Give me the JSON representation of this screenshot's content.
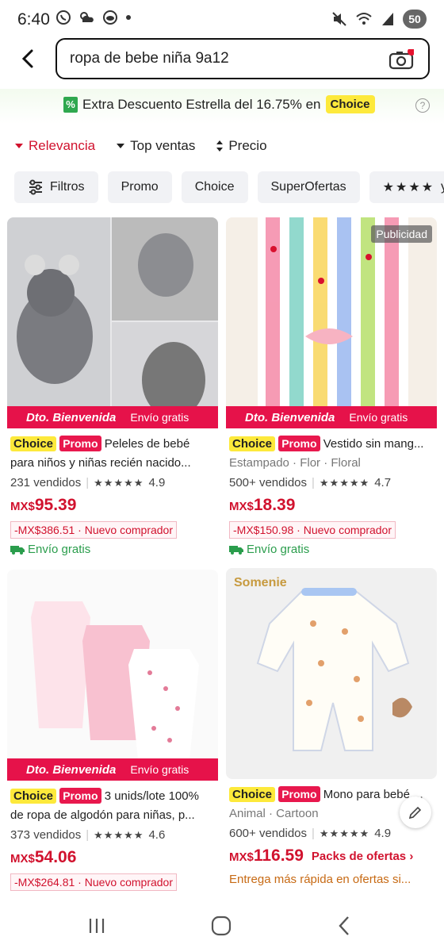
{
  "status": {
    "time": "6:40",
    "battery": "50"
  },
  "search": {
    "query": "ropa de bebe niña 9a12"
  },
  "banner": {
    "text": "Extra Descuento Estrella del 16.75% en",
    "badge": "Choice",
    "pct": "%"
  },
  "sort": [
    {
      "label": "Relevancia"
    },
    {
      "label": "Top ventas"
    },
    {
      "label": "Precio"
    }
  ],
  "chips": {
    "filters": "Filtros",
    "promo": "Promo",
    "choice": "Choice",
    "superofertas": "SuperOfertas",
    "stars_suffix": "y"
  },
  "dto": {
    "title": "Dto. Bienvenida",
    "ship": "Envío gratis"
  },
  "ad_label": "Publicidad",
  "tags": {
    "choice": "Choice",
    "promo": "Promo"
  },
  "products": [
    {
      "title": "Peleles de bebé",
      "title2": "para niños y niñas recién nacido...",
      "sold": "231 vendidos",
      "rating": "4.9",
      "currency": "MX$",
      "price": "95.39",
      "discount": "-MX$386.51",
      "buyer": "Nuevo comprador",
      "shipping": "Envío gratis"
    },
    {
      "title": "Vestido sin mang...",
      "attrs": "Estampado · Flor · Floral",
      "sold": "500+ vendidos",
      "rating": "4.7",
      "currency": "MX$",
      "price": "18.39",
      "discount": "-MX$150.98",
      "buyer": "Nuevo comprador",
      "shipping": "Envío gratis"
    },
    {
      "title": "3 unids/lote 100%",
      "title2": "de ropa de algodón para niñas, p...",
      "sold": "373 vendidos",
      "rating": "4.6",
      "currency": "MX$",
      "price": "54.06",
      "discount": "-MX$264.81",
      "buyer": "Nuevo comprador"
    },
    {
      "title": "Mono para bebé ...",
      "attrs": "Animal · Cartoon",
      "sold": "600+ vendidos",
      "rating": "4.9",
      "currency": "MX$",
      "price": "116.59",
      "pack": "Packs de ofertas",
      "delivery": "Entrega más rápida en ofertas si...",
      "brand": "Somenie"
    }
  ],
  "colors": {
    "accent": "#d1122e",
    "dto": "#e6124a",
    "choice": "#fde93b",
    "green": "#2a9d4c"
  }
}
